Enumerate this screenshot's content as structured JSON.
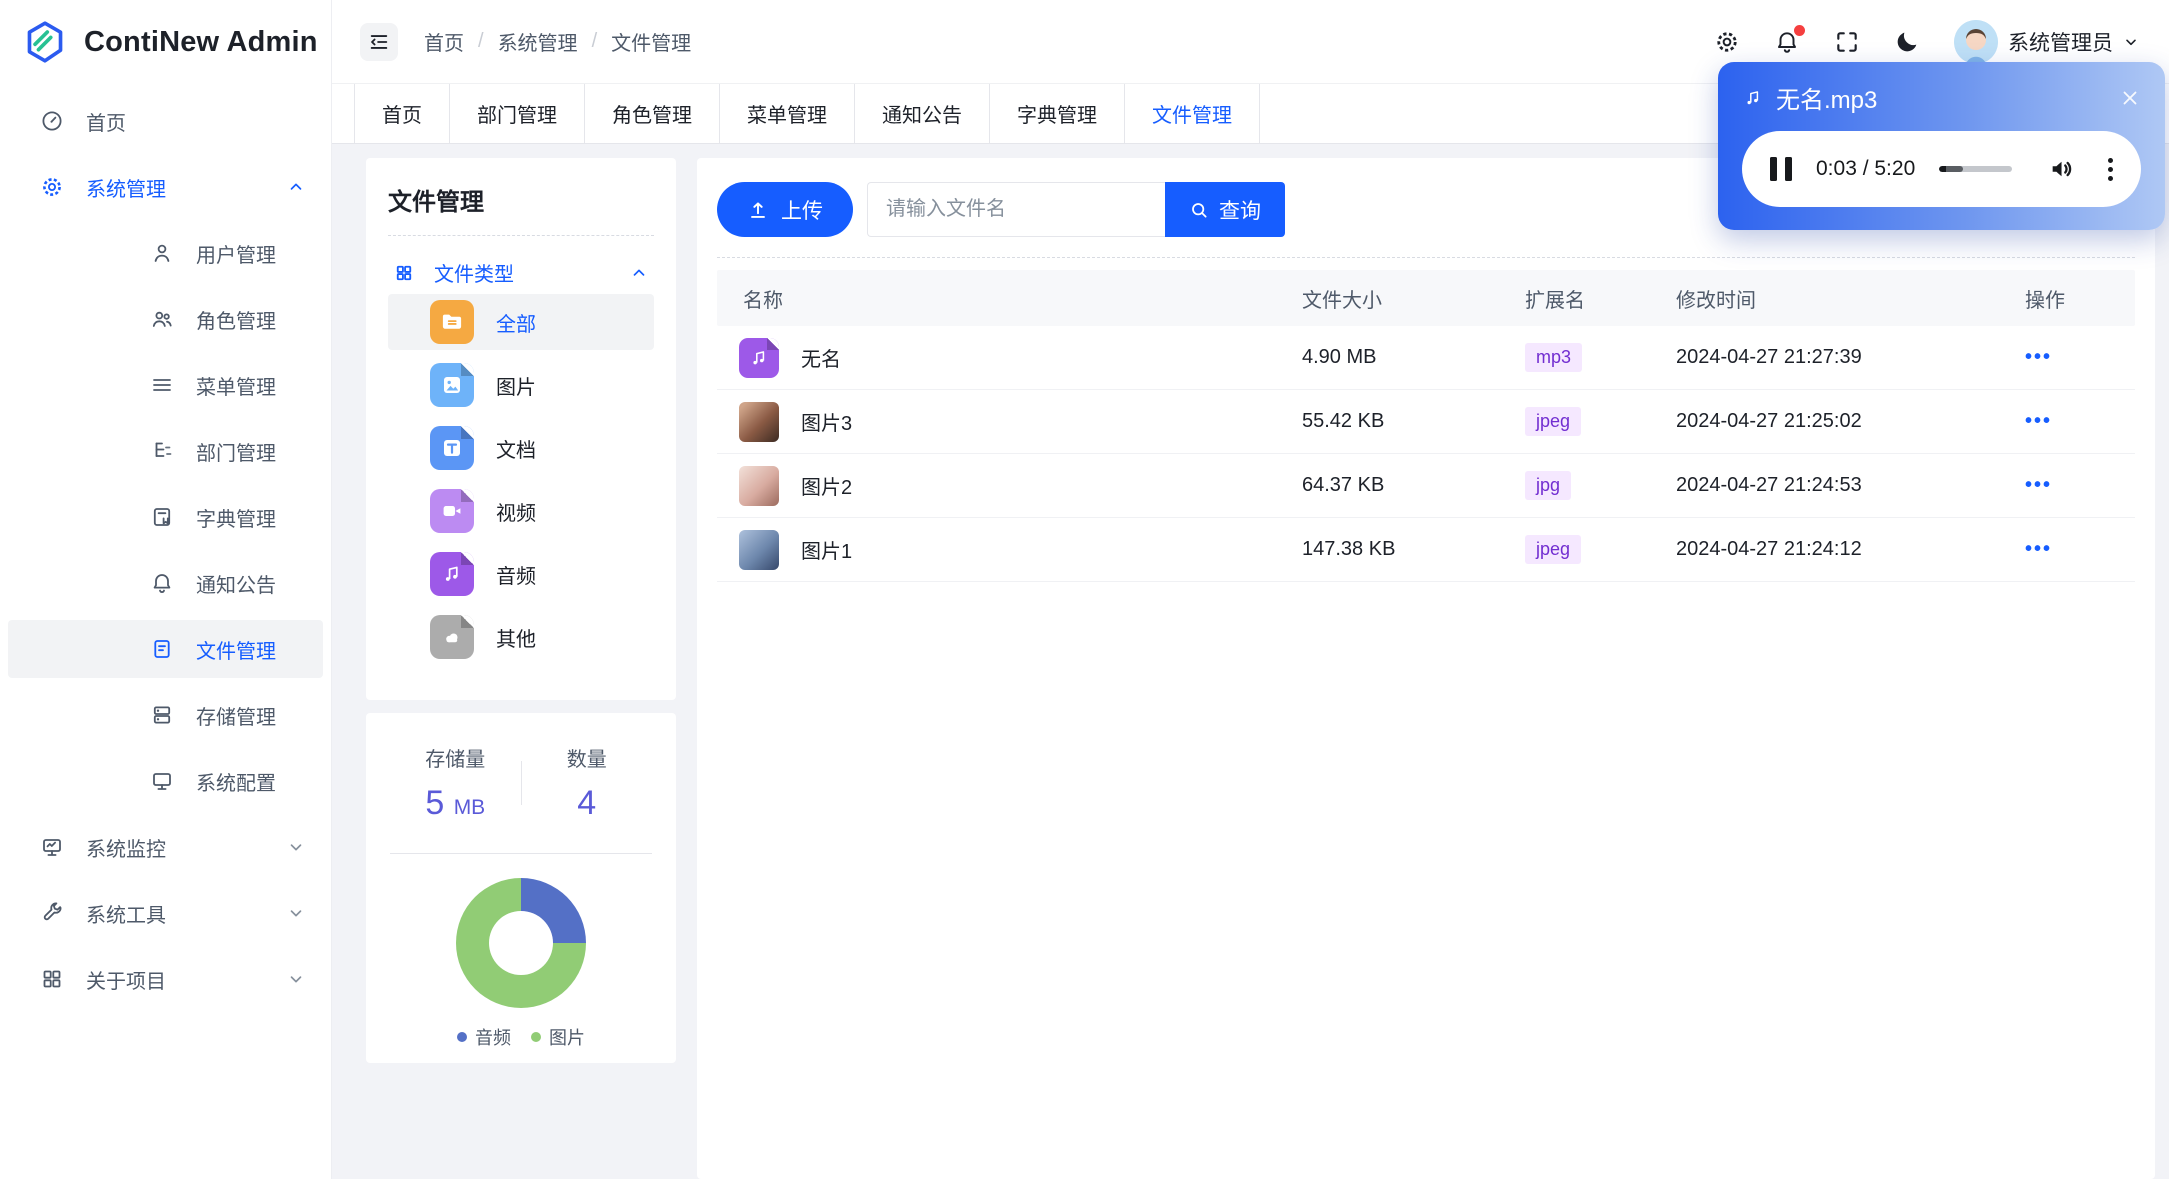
{
  "app": {
    "title": "ContiNew Admin"
  },
  "topbar": {
    "breadcrumb": {
      "items": [
        "首页",
        "系统管理",
        "文件管理"
      ],
      "separator": "/"
    },
    "user": {
      "name": "系统管理员"
    }
  },
  "tabs": {
    "items": [
      "首页",
      "部门管理",
      "角色管理",
      "菜单管理",
      "通知公告",
      "字典管理",
      "文件管理"
    ],
    "active": "文件管理"
  },
  "sidebar": {
    "items": [
      {
        "label": "首页"
      },
      {
        "label": "系统管理"
      },
      {
        "label": "用户管理"
      },
      {
        "label": "角色管理"
      },
      {
        "label": "菜单管理"
      },
      {
        "label": "部门管理"
      },
      {
        "label": "字典管理"
      },
      {
        "label": "通知公告"
      },
      {
        "label": "文件管理"
      },
      {
        "label": "存储管理"
      },
      {
        "label": "系统配置"
      },
      {
        "label": "系统监控"
      },
      {
        "label": "系统工具"
      },
      {
        "label": "关于项目"
      }
    ],
    "active": "文件管理"
  },
  "file_panel": {
    "title": "文件管理",
    "tree_label": "文件类型",
    "active_type": "全部",
    "types": [
      {
        "label": "全部",
        "color": "#F5A942"
      },
      {
        "label": "图片",
        "color": "#6EB3F9"
      },
      {
        "label": "文档",
        "color": "#5B96F5"
      },
      {
        "label": "视频",
        "color": "#BC8BF2"
      },
      {
        "label": "音频",
        "color": "#9D59E8"
      },
      {
        "label": "其他",
        "color": "#ACACAC"
      }
    ]
  },
  "stats": {
    "storage": {
      "label": "存储量",
      "value": "5",
      "unit": "MB"
    },
    "count": {
      "label": "数量",
      "value": "4"
    },
    "value_color": "#5A5AD8"
  },
  "chart_data": {
    "type": "pie",
    "donut": true,
    "categories": [
      "音频",
      "图片"
    ],
    "values": [
      1,
      3
    ],
    "colors": [
      "#5470C6",
      "#91CC75"
    ],
    "legend_position": "bottom"
  },
  "toolbar": {
    "upload_label": "上传",
    "search_placeholder": "请输入文件名",
    "search_value": "",
    "query_label": "查询"
  },
  "table": {
    "columns": [
      "名称",
      "文件大小",
      "扩展名",
      "修改时间",
      "操作"
    ],
    "ext_tag_colors": {
      "bg": "#F5E8FF",
      "text": "#722ED1"
    },
    "rows": [
      {
        "name": "无名",
        "size": "4.90 MB",
        "ext": "mp3",
        "modified": "2024-04-27 21:27:39"
      },
      {
        "name": "图片3",
        "size": "55.42 KB",
        "ext": "jpeg",
        "modified": "2024-04-27 21:25:02"
      },
      {
        "name": "图片2",
        "size": "64.37 KB",
        "ext": "jpg",
        "modified": "2024-04-27 21:24:53"
      },
      {
        "name": "图片1",
        "size": "147.38 KB",
        "ext": "jpeg",
        "modified": "2024-04-27 21:24:12"
      }
    ]
  },
  "audio_player": {
    "title": "无名.mp3",
    "current_time": "0:03",
    "duration": "5:20",
    "time_display": "0:03 / 5:20",
    "progress_percent": 33
  },
  "colors": {
    "primary": "#165DFF",
    "sidebar_text": "#4E5969",
    "text_dark": "#1D2129",
    "background": "#F2F3F7",
    "notification_dot": "#F53F3F"
  }
}
